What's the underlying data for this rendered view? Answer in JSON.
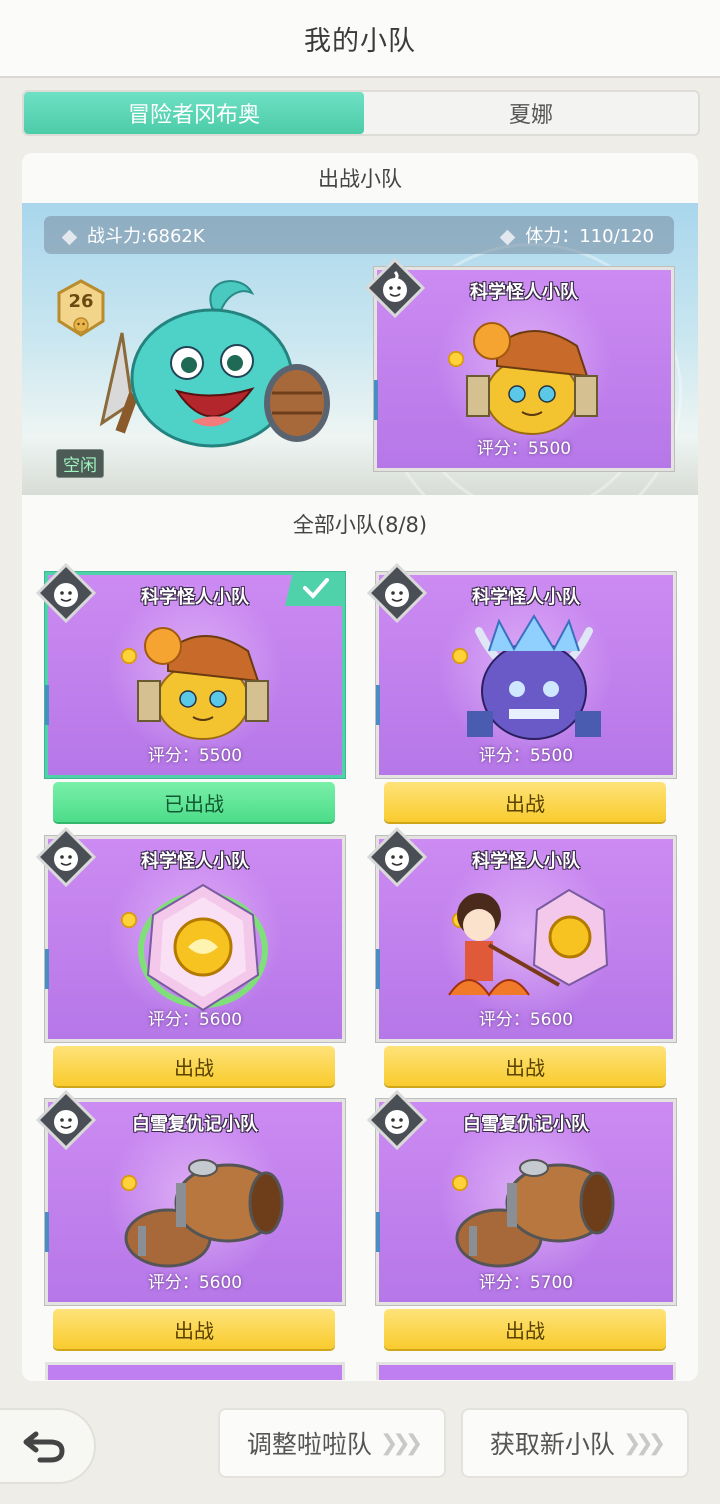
{
  "header": {
    "title": "我的小队"
  },
  "tabs": [
    {
      "label": "冒险者冈布奥",
      "active": true
    },
    {
      "label": "夏娜",
      "active": false
    }
  ],
  "battle_section": {
    "title": "出战小队",
    "power_label": "战斗力:6862K",
    "stamina_label": "体力：110/120",
    "level": "26",
    "status_tag": "空闲",
    "active_team": {
      "name": "科学怪人小队",
      "score": "评分：5500",
      "art": "apple-knight"
    }
  },
  "all_section": {
    "title": "全部小队(8/8)"
  },
  "teams": [
    {
      "name": "科学怪人小队",
      "score": "评分：5500",
      "button": "已出战",
      "deployed": true,
      "art": "apple-knight"
    },
    {
      "name": "科学怪人小队",
      "score": "评分：5500",
      "button": "出战",
      "deployed": false,
      "art": "ice-demon"
    },
    {
      "name": "科学怪人小队",
      "score": "评分：5600",
      "button": "出战",
      "deployed": false,
      "art": "crystal"
    },
    {
      "name": "科学怪人小队",
      "score": "评分：5600",
      "button": "出战",
      "deployed": false,
      "art": "fire-girl"
    },
    {
      "name": "白雪复仇记小队",
      "score": "评分：5600",
      "button": "出战",
      "deployed": false,
      "art": "barrels"
    },
    {
      "name": "白雪复仇记小队",
      "score": "评分：5700",
      "button": "出战",
      "deployed": false,
      "art": "barrels"
    }
  ],
  "footer": {
    "cheer_button": "调整啦啦队",
    "new_team_button": "获取新小队",
    "back_icon": "back-arrow-icon"
  },
  "colors": {
    "accent": "#4ccca8",
    "card": "#c07ff0",
    "deploy": "#f8cb2d",
    "deployed": "#4cdc8a"
  }
}
